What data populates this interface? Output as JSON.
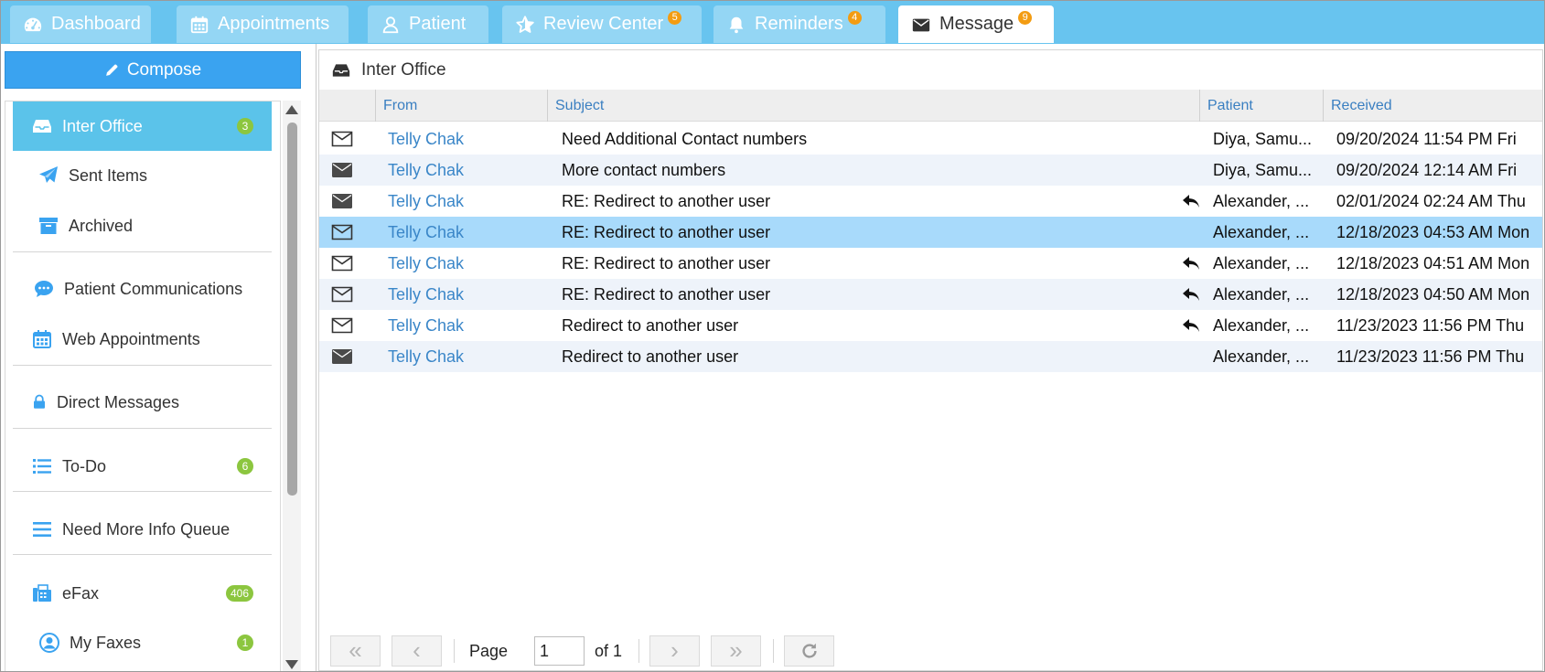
{
  "tabs": [
    {
      "label": "Dashboard",
      "icon": "dashboard-icon",
      "badge": ""
    },
    {
      "label": "Appointments",
      "icon": "calendar-icon",
      "badge": ""
    },
    {
      "label": "Patient",
      "icon": "user-icon",
      "badge": ""
    },
    {
      "label": "Review Center",
      "icon": "star-icon",
      "badge": "5"
    },
    {
      "label": "Reminders",
      "icon": "bell-icon",
      "badge": "4"
    },
    {
      "label": "Message",
      "icon": "envelope-icon",
      "badge": "9",
      "active": true
    }
  ],
  "sidebar": {
    "compose_label": "Compose",
    "items": [
      {
        "label": "Inter Office",
        "icon": "inbox-icon",
        "count": "3",
        "active": true
      },
      {
        "label": "Sent Items",
        "icon": "paper-plane-icon",
        "count": ""
      },
      {
        "label": "Archived",
        "icon": "archive-icon",
        "count": ""
      },
      {
        "label": "Patient Communications",
        "icon": "chat-bubble-icon",
        "count": ""
      },
      {
        "label": "Web Appointments",
        "icon": "calendar-icon",
        "count": ""
      },
      {
        "label": "Direct Messages",
        "icon": "lock-icon",
        "count": ""
      },
      {
        "label": "To-Do",
        "icon": "list-icon",
        "count": "6"
      },
      {
        "label": "Need More Info Queue",
        "icon": "menu-lines-icon",
        "count": ""
      },
      {
        "label": "eFax",
        "icon": "fax-icon",
        "count": "406"
      },
      {
        "label": "My Faxes",
        "icon": "user-circle-icon",
        "count": "1"
      }
    ]
  },
  "main": {
    "title": "Inter Office",
    "columns": {
      "from": "From",
      "subject": "Subject",
      "patient": "Patient",
      "received": "Received"
    },
    "rows": [
      {
        "read": false,
        "from": "Telly Chak",
        "subject": "Need Additional Contact numbers",
        "replied": false,
        "patient": "Diya, Samu...",
        "received": "09/20/2024 11:54 PM Fri"
      },
      {
        "read": true,
        "from": "Telly Chak",
        "subject": "More contact numbers",
        "replied": false,
        "patient": "Diya, Samu...",
        "received": "09/20/2024 12:14 AM Fri"
      },
      {
        "read": true,
        "from": "Telly Chak",
        "subject": "RE: Redirect to another user",
        "replied": true,
        "patient": "Alexander, ...",
        "received": "02/01/2024 02:24 AM Thu"
      },
      {
        "read": false,
        "from": "Telly Chak",
        "subject": "RE: Redirect to another user",
        "replied": false,
        "patient": "Alexander, ...",
        "received": "12/18/2023 04:53 AM Mon",
        "selected": true
      },
      {
        "read": false,
        "from": "Telly Chak",
        "subject": "RE: Redirect to another user",
        "replied": true,
        "patient": "Alexander, ...",
        "received": "12/18/2023 04:51 AM Mon"
      },
      {
        "read": false,
        "from": "Telly Chak",
        "subject": "RE: Redirect to another user",
        "replied": true,
        "patient": "Alexander, ...",
        "received": "12/18/2023 04:50 AM Mon"
      },
      {
        "read": false,
        "from": "Telly Chak",
        "subject": "Redirect to another user",
        "replied": true,
        "patient": "Alexander, ...",
        "received": "11/23/2023 11:56 PM Thu"
      },
      {
        "read": true,
        "from": "Telly Chak",
        "subject": "Redirect to another user",
        "replied": false,
        "patient": "Alexander, ...",
        "received": "11/23/2023 11:56 PM Thu"
      }
    ]
  },
  "pager": {
    "first_glyph": "«",
    "prev_glyph": "‹",
    "next_glyph": "›",
    "last_glyph": "»",
    "page_label": "Page",
    "page_value": "1",
    "of_label": "of 1"
  },
  "colors": {
    "tabbar": "#68c4ef",
    "tab": "#94d6f4",
    "accent": "#3aa3f0",
    "active_nav": "#5bc3ea",
    "link": "#3a86c8",
    "badge_green": "#8cc63f",
    "badge_orange": "#f39c12",
    "selected_row": "#a8dafb"
  }
}
